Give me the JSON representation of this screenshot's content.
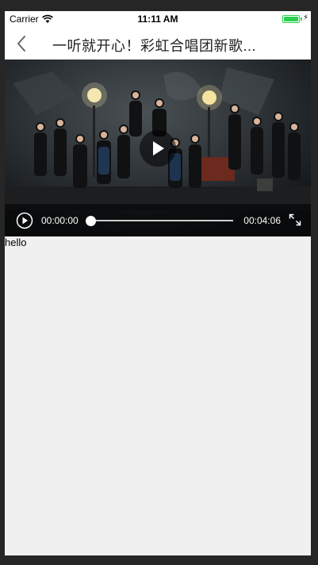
{
  "status_bar": {
    "carrier": "Carrier",
    "time": "11:11 AM",
    "battery_color": "#2bd14f"
  },
  "nav": {
    "back_icon": "chevron-left-icon",
    "title": "一听就开心！彩虹合唱团新歌..."
  },
  "video": {
    "current_time": "00:00:00",
    "total_time": "00:04:06",
    "progress": 0,
    "icons": {
      "center": "play-icon",
      "control": "play-circle-icon",
      "fullscreen": "expand-icon"
    }
  },
  "content": {
    "text": "hello"
  }
}
